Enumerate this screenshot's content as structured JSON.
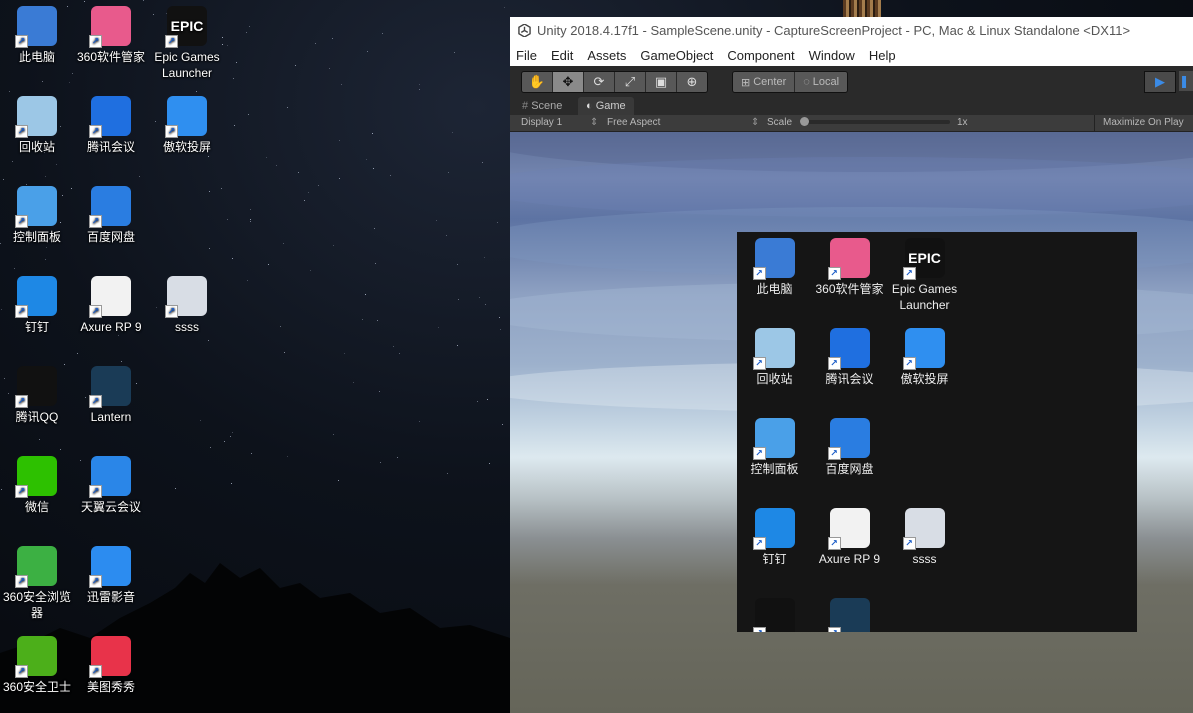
{
  "desktop": {
    "icons": [
      {
        "label": "此电脑",
        "icon": "computer-icon",
        "color": "#3a7bd5"
      },
      {
        "label": "360软件管家",
        "icon": "360-software-manager-icon",
        "color": "#e85a8c"
      },
      {
        "label": "Epic Games Launcher",
        "icon": "epic-games-icon",
        "color": "#111111",
        "logo_text": "EPIC"
      },
      {
        "label": "回收站",
        "icon": "recycle-bin-icon",
        "color": "#9cc7e6"
      },
      {
        "label": "腾讯会议",
        "icon": "tencent-meeting-icon",
        "color": "#1f6fe0"
      },
      {
        "label": "傲软投屏",
        "icon": "apowermirror-icon",
        "color": "#2f8ff0"
      },
      {
        "label": "控制面板",
        "icon": "control-panel-icon",
        "color": "#4aa0e8"
      },
      {
        "label": "百度网盘",
        "icon": "baidu-netdisk-icon",
        "color": "#2a7de1"
      },
      {
        "label": "钉钉",
        "icon": "dingtalk-icon",
        "color": "#1e88e5"
      },
      {
        "label": "Axure RP 9",
        "icon": "axure-icon",
        "color": "#f2f2f2"
      },
      {
        "label": "ssss",
        "icon": "file-icon",
        "color": "#d8dde5"
      },
      {
        "label": "腾讯QQ",
        "icon": "qq-icon",
        "color": "#111111"
      },
      {
        "label": "Lantern",
        "icon": "lantern-icon",
        "color": "#1a3b56"
      },
      {
        "label": "微信",
        "icon": "wechat-icon",
        "color": "#2dc100"
      },
      {
        "label": "天翼云会议",
        "icon": "tianyi-meeting-icon",
        "color": "#2a86e8"
      },
      {
        "label": "360安全浏览器",
        "icon": "360-browser-icon",
        "color": "#3cb043"
      },
      {
        "label": "迅雷影音",
        "icon": "xunlei-player-icon",
        "color": "#2c8cf0"
      },
      {
        "label": "360安全卫士",
        "icon": "360-security-icon",
        "color": "#4caf1a"
      },
      {
        "label": "美图秀秀",
        "icon": "meitu-icon",
        "color": "#e8334a"
      }
    ]
  },
  "unity": {
    "title": "Unity 2018.4.17f1 - SampleScene.unity - CaptureScreenProject - PC, Mac & Linux Standalone <DX11>",
    "menu": [
      "File",
      "Edit",
      "Assets",
      "GameObject",
      "Component",
      "Window",
      "Help"
    ],
    "toolbar": {
      "tools": [
        "hand-tool-icon",
        "move-tool-icon",
        "rotate-tool-icon",
        "scale-tool-icon",
        "rect-tool-icon",
        "transform-tool-icon"
      ],
      "pivot_center": "Center",
      "pivot_local": "Local"
    },
    "tabs": {
      "scene": "Scene",
      "game": "Game"
    },
    "gamebar": {
      "display": "Display 1",
      "aspect": "Free Aspect",
      "scale_label": "Scale",
      "scale_value": "1x",
      "maximize": "Maximize On Play"
    },
    "capture_icons": [
      {
        "label": "此电脑",
        "icon": "computer-icon",
        "color": "#3a7bd5"
      },
      {
        "label": "360软件管家",
        "icon": "360-software-manager-icon",
        "color": "#e85a8c"
      },
      {
        "label": "Epic Games Launcher",
        "icon": "epic-games-icon",
        "color": "#111111",
        "logo_text": "EPIC"
      },
      {
        "label": "回收站",
        "icon": "recycle-bin-icon",
        "color": "#9cc7e6"
      },
      {
        "label": "腾讯会议",
        "icon": "tencent-meeting-icon",
        "color": "#1f6fe0"
      },
      {
        "label": "傲软投屏",
        "icon": "apowermirror-icon",
        "color": "#2f8ff0"
      },
      {
        "label": "控制面板",
        "icon": "control-panel-icon",
        "color": "#4aa0e8"
      },
      {
        "label": "百度网盘",
        "icon": "baidu-netdisk-icon",
        "color": "#2a7de1"
      },
      {
        "label": "钉钉",
        "icon": "dingtalk-icon",
        "color": "#1e88e5"
      },
      {
        "label": "Axure RP 9",
        "icon": "axure-icon",
        "color": "#f2f2f2"
      },
      {
        "label": "ssss",
        "icon": "file-icon",
        "color": "#d8dde5"
      },
      {
        "label": "",
        "icon": "qq-icon",
        "color": "#111111"
      },
      {
        "label": "",
        "icon": "lantern-icon",
        "color": "#1a3b56"
      }
    ]
  }
}
